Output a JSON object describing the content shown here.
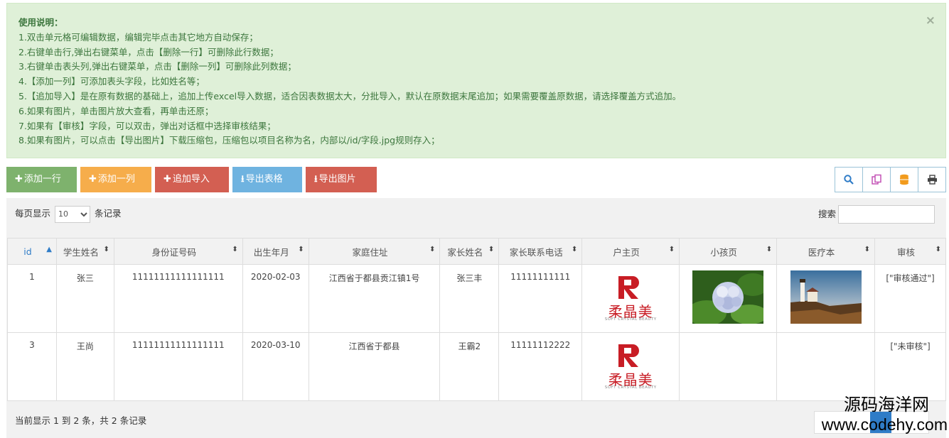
{
  "notice": {
    "title": "使用说明：",
    "close": "×",
    "lines": [
      "1.双击单元格可编辑数据，编辑完毕点击其它地方自动保存；",
      "2.右键单击行,弹出右键菜单，点击【删除一行】可删除此行数据；",
      "3.右键单击表头列,弹出右键菜单，点击【删除一列】可删除此列数据；",
      "4.【添加一列】可添加表头字段，比如姓名等；",
      "5.【追加导入】是在原有数据的基础上，追加上传excel导入数据，适合因表数据太大，分批导入，默认在原数据末尾追加；如果需要覆盖原数据，请选择覆盖方式追加。",
      "6.如果有图片，单击图片放大查看，再单击还原；",
      "7.如果有【审核】字段，可以双击，弹出对话框中选择审核结果；",
      "8.如果有图片，可以点击【导出图片】下载压缩包，压缩包以项目名称为名，内部以/id/字段.jpg规则存入；"
    ]
  },
  "toolbar": {
    "add_row": "添加一行",
    "add_col": "添加一列",
    "append_import": "追加导入",
    "export_table": "导出表格",
    "export_images": "导出图片",
    "icons": [
      "search-icon",
      "copy-icon",
      "database-icon",
      "print-icon"
    ]
  },
  "table_controls": {
    "per_page_prefix": "每页显示",
    "per_page_value": "10",
    "per_page_suffix": "条记录",
    "search_label": "搜索",
    "search_value": ""
  },
  "columns": [
    "id",
    "学生姓名",
    "身份证号码",
    "出生年月",
    "家庭住址",
    "家长姓名",
    "家长联系电话",
    "户主页",
    "小孩页",
    "医疗本",
    "审核"
  ],
  "rows": [
    {
      "id": "1",
      "name": "张三",
      "idcard": "11111111111111111",
      "birth": "2020-02-03",
      "address": "江西省于都县贡江镇1号",
      "parent": "张三丰",
      "phone": "11111111111",
      "household": "logo",
      "child": "flower-photo",
      "medical": "lighthouse-photo",
      "review": "[\"审核通过\"]"
    },
    {
      "id": "3",
      "name": "王尚",
      "idcard": "11111111111111111",
      "birth": "2020-03-10",
      "address": "江西省于都县",
      "parent": "王霸2",
      "phone": "11111112222",
      "household": "logo",
      "child": "",
      "medical": "",
      "review": "[\"未审核\"]"
    }
  ],
  "logo": {
    "cn": "柔晶美",
    "en": "SOFT CRYSTAL BEAUTY",
    "color": "#c81d25"
  },
  "footer_info": "当前显示 1 到 2 条，共 2 条记录",
  "watermark": {
    "line1": "源码海洋网",
    "line2": "www.codehy.com"
  },
  "colors": {
    "notice_bg": "#dff0d8",
    "green": "#7eb26d",
    "orange": "#f6ad4b",
    "red": "#d35f52",
    "blue": "#6fb3e0",
    "link": "#2f7cc7"
  }
}
